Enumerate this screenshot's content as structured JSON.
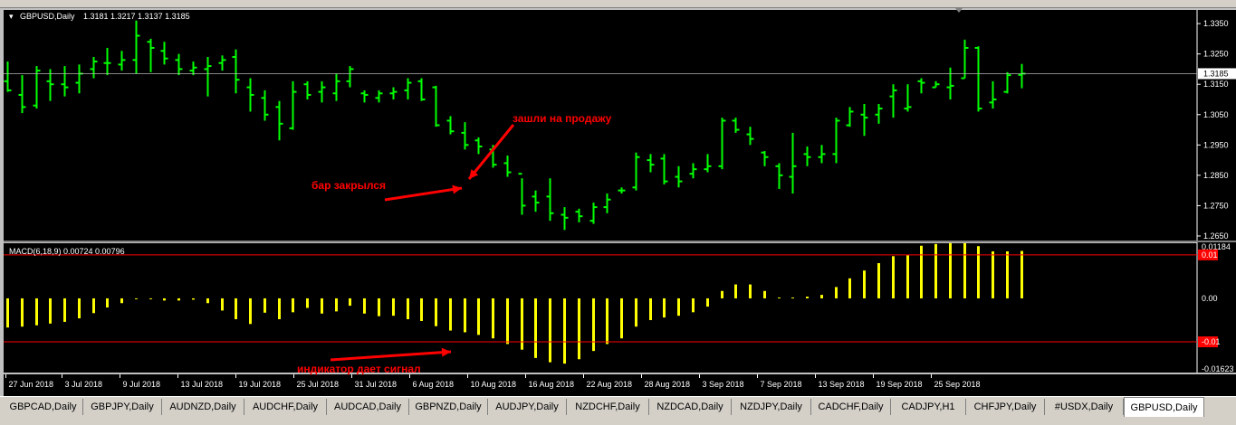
{
  "chart_data": [
    {
      "type": "ohlc",
      "title": "GBPUSD,Daily",
      "ohlc_header": "1.3181 1.3217 1.3137 1.3185",
      "ylim": [
        1.2635,
        1.3395
      ],
      "yticks": [
        "1.3350",
        "1.3250",
        "1.3150",
        "1.3050",
        "1.2950",
        "1.2850",
        "1.2750",
        "1.2650"
      ],
      "current_price": "1.3185",
      "x_labels": [
        "27 Jun 2018",
        "3 Jul 2018",
        "9 Jul 2018",
        "13 Jul 2018",
        "19 Jul 2018",
        "25 Jul 2018",
        "31 Jul 2018",
        "6 Aug 2018",
        "10 Aug 2018",
        "16 Aug 2018",
        "22 Aug 2018",
        "28 Aug 2018",
        "3 Sep 2018",
        "7 Sep 2018",
        "13 Sep 2018",
        "19 Sep 2018",
        "25 Sep 2018"
      ],
      "bars": [
        [
          1.316,
          1.3225,
          1.3125,
          1.313
        ],
        [
          1.3115,
          1.318,
          1.3055,
          1.3075
        ],
        [
          1.308,
          1.321,
          1.307,
          1.3195
        ],
        [
          1.316,
          1.32,
          1.3095,
          1.315
        ],
        [
          1.315,
          1.321,
          1.311,
          1.314
        ],
        [
          1.3155,
          1.3215,
          1.312,
          1.3185
        ],
        [
          1.32,
          1.324,
          1.317,
          1.3225
        ],
        [
          1.322,
          1.327,
          1.318,
          1.322
        ],
        [
          1.3215,
          1.326,
          1.3195,
          1.323
        ],
        [
          1.323,
          1.336,
          1.3185,
          1.331
        ],
        [
          1.329,
          1.33,
          1.319,
          1.327
        ],
        [
          1.326,
          1.329,
          1.3215,
          1.3235
        ],
        [
          1.323,
          1.325,
          1.318,
          1.32
        ],
        [
          1.3195,
          1.3225,
          1.318,
          1.3205
        ],
        [
          1.32,
          1.324,
          1.311,
          1.321
        ],
        [
          1.322,
          1.3245,
          1.3195,
          1.323
        ],
        [
          1.324,
          1.3265,
          1.312,
          1.3165
        ],
        [
          1.314,
          1.317,
          1.306,
          1.3115
        ],
        [
          1.3105,
          1.313,
          1.303,
          1.305
        ],
        [
          1.3075,
          1.3095,
          1.2965,
          1.302
        ],
        [
          1.3005,
          1.316,
          1.3,
          1.3125
        ],
        [
          1.315,
          1.316,
          1.31,
          1.3115
        ],
        [
          1.3125,
          1.316,
          1.309,
          1.314
        ],
        [
          1.312,
          1.3185,
          1.3095,
          1.316
        ],
        [
          1.316,
          1.321,
          1.314,
          1.32
        ],
        [
          1.312,
          1.313,
          1.309,
          1.3115
        ],
        [
          1.3105,
          1.313,
          1.309,
          1.312
        ],
        [
          1.312,
          1.314,
          1.31,
          1.3125
        ],
        [
          1.313,
          1.317,
          1.31,
          1.3155
        ],
        [
          1.316,
          1.317,
          1.3095,
          1.31
        ],
        [
          1.314,
          1.3145,
          1.301,
          1.3015
        ],
        [
          1.303,
          1.3045,
          1.2985,
          1.2995
        ],
        [
          1.299,
          1.3025,
          1.2935,
          1.295
        ],
        [
          1.2965,
          1.2975,
          1.292,
          1.2945
        ],
        [
          1.2935,
          1.295,
          1.2875,
          1.2885
        ],
        [
          1.289,
          1.2915,
          1.2845,
          1.286
        ],
        [
          1.2855,
          1.284,
          1.272,
          1.275
        ],
        [
          1.278,
          1.28,
          1.273,
          1.276
        ],
        [
          1.278,
          1.284,
          1.27,
          1.2725
        ],
        [
          1.272,
          1.2745,
          1.267,
          1.271
        ],
        [
          1.273,
          1.274,
          1.2695,
          1.2715
        ],
        [
          1.27,
          1.276,
          1.269,
          1.2745
        ],
        [
          1.2745,
          1.279,
          1.2725,
          1.277
        ],
        [
          1.28,
          1.281,
          1.279,
          1.28
        ],
        [
          1.281,
          1.2925,
          1.28,
          1.291
        ],
        [
          1.29,
          1.292,
          1.286,
          1.2885
        ],
        [
          1.2905,
          1.292,
          1.282,
          1.283
        ],
        [
          1.2845,
          1.288,
          1.281,
          1.283
        ],
        [
          1.2855,
          1.289,
          1.284,
          1.287
        ],
        [
          1.287,
          1.292,
          1.286,
          1.288
        ],
        [
          1.288,
          1.304,
          1.287,
          1.303
        ],
        [
          1.303,
          1.304,
          1.299,
          1.3
        ],
        [
          1.2985,
          1.301,
          1.295,
          1.297
        ],
        [
          1.2925,
          1.293,
          1.288,
          1.291
        ],
        [
          1.288,
          1.289,
          1.2805,
          1.285
        ],
        [
          1.2845,
          1.299,
          1.279,
          1.288
        ],
        [
          1.292,
          1.2945,
          1.288,
          1.291
        ],
        [
          1.291,
          1.295,
          1.289,
          1.292
        ],
        [
          1.292,
          1.304,
          1.289,
          1.303
        ],
        [
          1.3015,
          1.3075,
          1.301,
          1.306
        ],
        [
          1.305,
          1.3085,
          1.298,
          1.304
        ],
        [
          1.305,
          1.3085,
          1.302,
          1.307
        ],
        [
          1.311,
          1.315,
          1.304,
          1.313
        ],
        [
          1.307,
          1.315,
          1.306,
          1.3075
        ],
        [
          1.316,
          1.317,
          1.312,
          1.3155
        ],
        [
          1.314,
          1.316,
          1.314,
          1.315
        ],
        [
          1.314,
          1.3205,
          1.31,
          1.3145
        ],
        [
          1.317,
          1.3297,
          1.317,
          1.327
        ],
        [
          1.327,
          1.3275,
          1.306,
          1.307
        ],
        [
          1.309,
          1.316,
          1.307,
          1.31
        ],
        [
          1.3125,
          1.319,
          1.312,
          1.318
        ],
        [
          1.3181,
          1.3217,
          1.3137,
          1.3185
        ]
      ]
    },
    {
      "type": "bar",
      "title": "MACD(6,18,9) 0.00724 0.00796",
      "ylim": [
        -0.01623,
        0.01184
      ],
      "yticks": [
        "0.01184",
        "0.01",
        "0.00",
        "-0.01",
        "-0.01623"
      ],
      "levels": [
        0.01,
        -0.01
      ],
      "values": [
        -0.0067,
        -0.0065,
        -0.0062,
        -0.0058,
        -0.0054,
        -0.0046,
        -0.0034,
        -0.0021,
        -0.0011,
        -0.0002,
        -0.0002,
        -0.0005,
        -0.0005,
        -0.0003,
        -0.0011,
        -0.0028,
        -0.0048,
        -0.0059,
        -0.0033,
        -0.0048,
        -0.0032,
        -0.0022,
        -0.0035,
        -0.003,
        -0.0017,
        -0.0035,
        -0.0041,
        -0.004,
        -0.0048,
        -0.0052,
        -0.0064,
        -0.0074,
        -0.0078,
        -0.0084,
        -0.0092,
        -0.0105,
        -0.0118,
        -0.0137,
        -0.0147,
        -0.015,
        -0.014,
        -0.0121,
        -0.0105,
        -0.0092,
        -0.0065,
        -0.005,
        -0.0044,
        -0.004,
        -0.0032,
        -0.0019,
        0.0017,
        0.0032,
        0.0032,
        0.0017,
        0.0002,
        0.0002,
        0.0004,
        0.0008,
        0.0026,
        0.0046,
        0.0064,
        0.0081,
        0.0097,
        0.0099,
        0.0121,
        0.0125,
        0.0127,
        0.0127,
        0.012,
        0.0108,
        0.0108,
        0.0109
      ]
    }
  ],
  "annotations": {
    "bar_closed": "бар закрылся",
    "entered_sell": "зашли на продажу",
    "indicator_signal": "индикатор дает сигнал"
  },
  "colors": {
    "bull_bar": "#00ff00",
    "bear_bar": "#00ff00",
    "macd_bar": "#ffff00",
    "level_line": "#ff0000",
    "arrow": "#ff0000",
    "annotation_text": "#ff0000",
    "price_line": "#c0c0c0",
    "background": "#000000",
    "axis_text": "#ffffff"
  },
  "tabs": [
    "GBPCAD,Daily",
    "GBPJPY,Daily",
    "AUDNZD,Daily",
    "AUDCHF,Daily",
    "AUDCAD,Daily",
    "GBPNZD,Daily",
    "AUDJPY,Daily",
    "NZDCHF,Daily",
    "NZDCAD,Daily",
    "NZDJPY,Daily",
    "CADCHF,Daily",
    "CADJPY,H1",
    "CHFJPY,Daily",
    "#USDX,Daily",
    "GBPUSD,Daily"
  ],
  "active_tab": "GBPUSD,Daily"
}
